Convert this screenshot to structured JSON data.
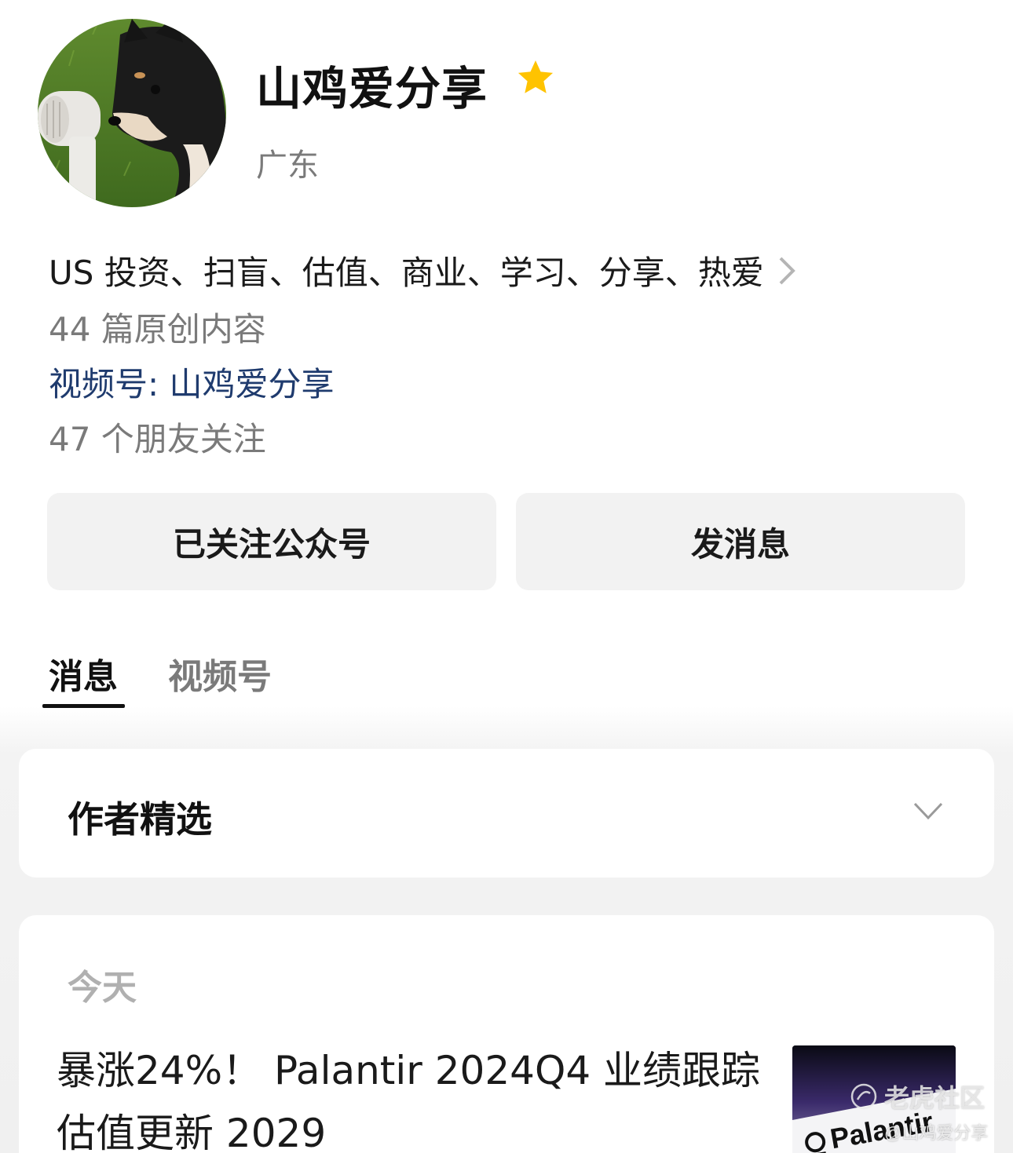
{
  "profile": {
    "name": "山鸡爱分享",
    "region": "广东",
    "bio": "US 投资、扫盲、估值、商业、学习、分享、热爱",
    "original_count": "44 篇原创内容",
    "channel": "视频号: 山鸡爱分享",
    "friends_following": "47 个朋友关注"
  },
  "actions": {
    "follow_label": "已关注公众号",
    "message_label": "发消息"
  },
  "tabs": [
    {
      "label": "消息",
      "active": true
    },
    {
      "label": "视频号",
      "active": false
    }
  ],
  "featured": {
    "title": "作者精选"
  },
  "feed": {
    "date_label": "今天",
    "article": {
      "title": "暴涨24%！ Palantir 2024Q4 业绩跟踪估值更新 2029",
      "thumbnail_text": "Palantir"
    }
  },
  "watermark": {
    "brand": "老虎社区",
    "author": "@山鸡爱分享"
  },
  "colors": {
    "star": "#FFC300",
    "channel_link": "#1F3B6E",
    "button_bg": "#F2F2F2"
  }
}
